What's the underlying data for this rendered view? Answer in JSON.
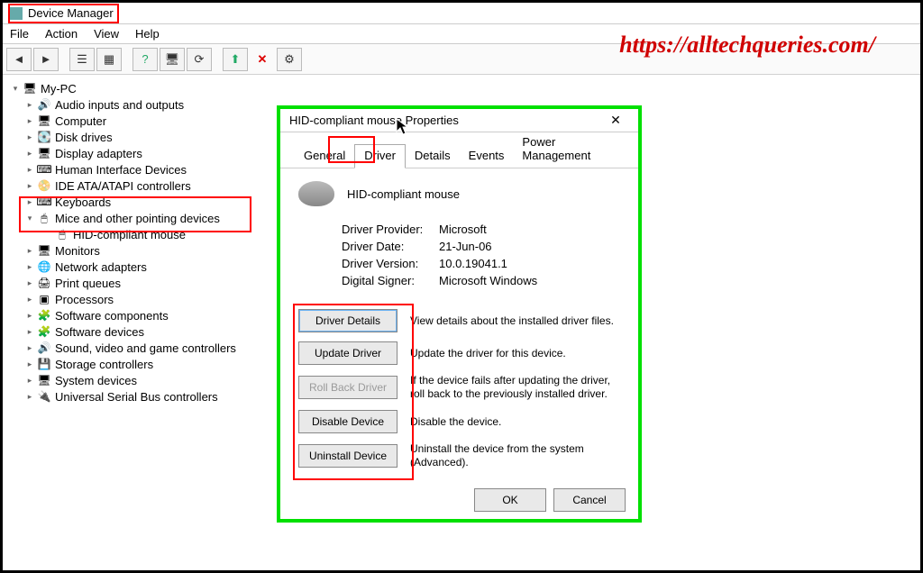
{
  "window": {
    "title": "Device Manager",
    "menus": [
      "File",
      "Action",
      "View",
      "Help"
    ]
  },
  "watermark": "https://alltechqueries.com/",
  "tree": {
    "root": "My-PC",
    "items": [
      {
        "icon": "🔊",
        "label": "Audio inputs and outputs"
      },
      {
        "icon": "🖥",
        "label": "Computer"
      },
      {
        "icon": "💽",
        "label": "Disk drives"
      },
      {
        "icon": "🖥",
        "label": "Display adapters"
      },
      {
        "icon": "⌨",
        "label": "Human Interface Devices"
      },
      {
        "icon": "📀",
        "label": "IDE ATA/ATAPI controllers"
      },
      {
        "icon": "⌨",
        "label": "Keyboards"
      },
      {
        "icon": "🖱",
        "label": "Mice and other pointing devices",
        "expanded": true,
        "children": [
          {
            "icon": "🖱",
            "label": "HID-compliant mouse"
          }
        ]
      },
      {
        "icon": "🖥",
        "label": "Monitors"
      },
      {
        "icon": "🌐",
        "label": "Network adapters"
      },
      {
        "icon": "🖨",
        "label": "Print queues"
      },
      {
        "icon": "▣",
        "label": "Processors"
      },
      {
        "icon": "🧩",
        "label": "Software components"
      },
      {
        "icon": "🧩",
        "label": "Software devices"
      },
      {
        "icon": "🔊",
        "label": "Sound, video and game controllers"
      },
      {
        "icon": "💾",
        "label": "Storage controllers"
      },
      {
        "icon": "🖥",
        "label": "System devices"
      },
      {
        "icon": "🔌",
        "label": "Universal Serial Bus controllers"
      }
    ]
  },
  "dialog": {
    "title": "HID-compliant mouse Properties",
    "tabs": [
      "General",
      "Driver",
      "Details",
      "Events",
      "Power Management"
    ],
    "active_tab": "Driver",
    "device_name": "HID-compliant mouse",
    "rows": {
      "provider_label": "Driver Provider:",
      "provider_value": "Microsoft",
      "date_label": "Driver Date:",
      "date_value": "21-Jun-06",
      "version_label": "Driver Version:",
      "version_value": "10.0.19041.1",
      "signer_label": "Digital Signer:",
      "signer_value": "Microsoft Windows"
    },
    "buttons": {
      "details": {
        "label": "Driver Details",
        "desc": "View details about the installed driver files."
      },
      "update": {
        "label": "Update Driver",
        "desc": "Update the driver for this device."
      },
      "rollback": {
        "label": "Roll Back Driver",
        "desc": "If the device fails after updating the driver, roll back to the previously installed driver."
      },
      "disable": {
        "label": "Disable Device",
        "desc": "Disable the device."
      },
      "uninstall": {
        "label": "Uninstall Device",
        "desc": "Uninstall the device from the system (Advanced)."
      }
    },
    "ok": "OK",
    "cancel": "Cancel"
  }
}
